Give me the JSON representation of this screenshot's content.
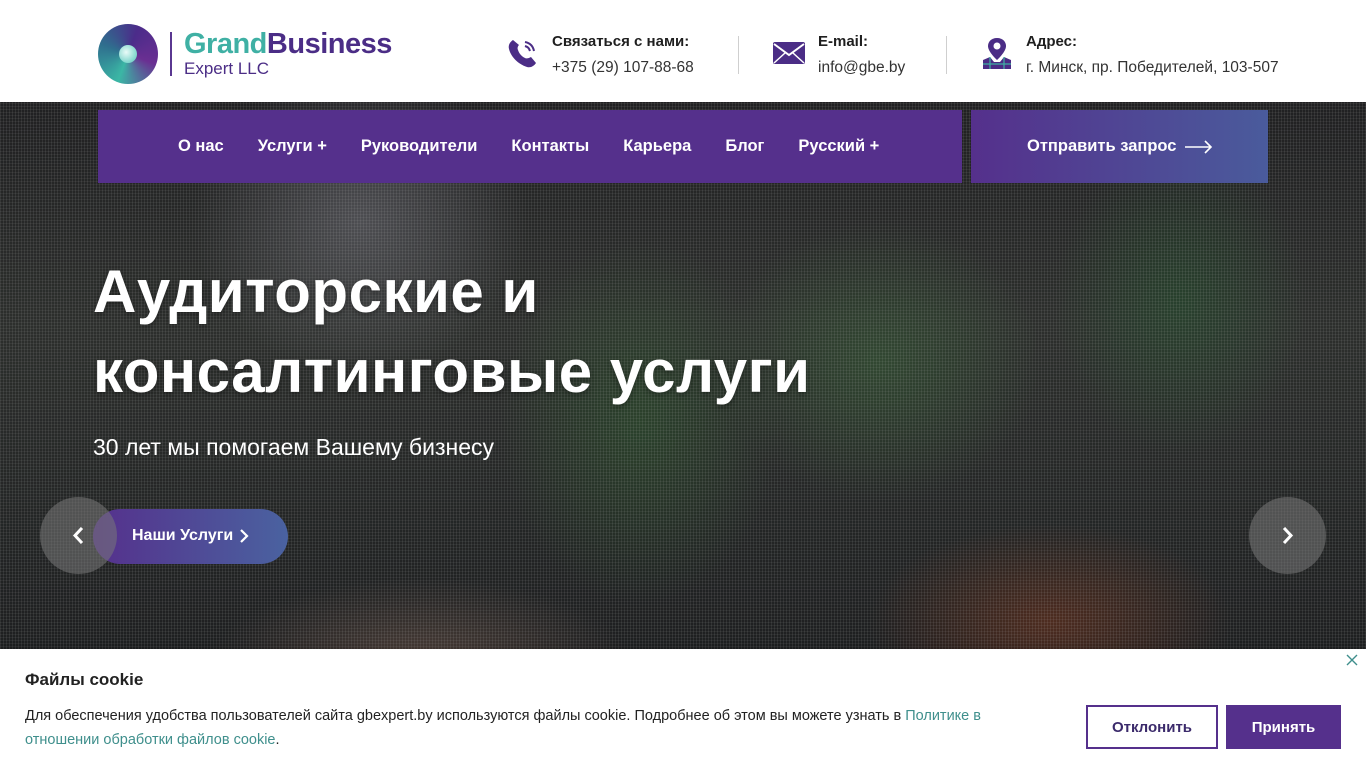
{
  "logo": {
    "grand": "Grand",
    "business": "Business",
    "sub": "Expert LLC"
  },
  "contacts": {
    "phone": {
      "title": "Связаться с нами:",
      "value": "+375 (29) 107-88-68",
      "icon": "phone-icon"
    },
    "email": {
      "title": "E-mail:",
      "value": "info@gbe.by",
      "icon": "envelope-icon"
    },
    "address": {
      "title": "Адрес:",
      "value": "г. Минск, пр. Победителей, 103-507",
      "icon": "map-pin-icon"
    }
  },
  "nav": {
    "items": [
      {
        "label": "О нас"
      },
      {
        "label": "Услуги +"
      },
      {
        "label": "Руководители"
      },
      {
        "label": "Контакты"
      },
      {
        "label": "Карьера"
      },
      {
        "label": "Блог"
      },
      {
        "label": "Русский +"
      }
    ],
    "cta": "Отправить запрос"
  },
  "hero": {
    "title_line1": "Аудиторские и",
    "title_line2": "консалтинговые услуги",
    "subtitle": "30 лет мы помогаем Вашему бизнесу",
    "button": "Наши Услуги"
  },
  "cookie": {
    "title": "Файлы cookie",
    "text": "Для обеспечения удобства пользователей сайта gbexpert.by используются файлы cookie. Подробнее об этом вы можете узнать в ",
    "link": "Политике в отношении обработки файлов cookie",
    "end": ".",
    "decline": "Отклонить",
    "accept": "Принять"
  },
  "colors": {
    "brand_purple": "#55308c",
    "brand_teal": "#3fb0a4",
    "link": "#3f8f8c"
  }
}
